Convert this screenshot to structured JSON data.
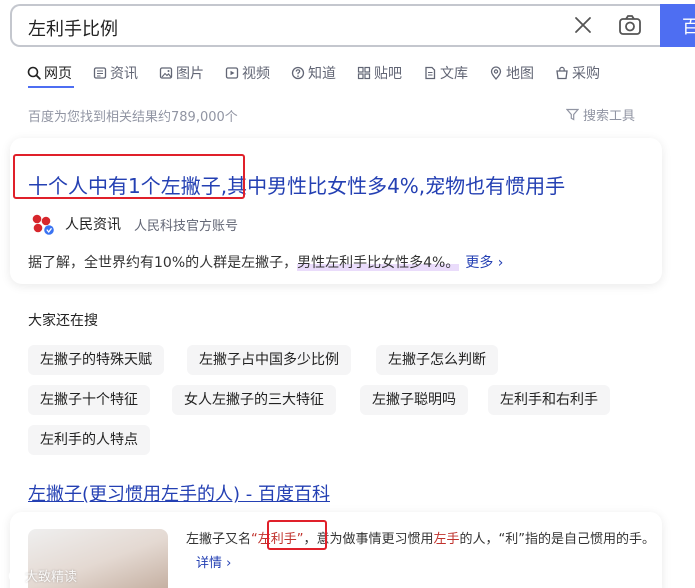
{
  "search": {
    "query": "左利手比例",
    "button_label": "百度一下"
  },
  "tabs": [
    {
      "label": "网页",
      "icon": "search-icon",
      "active": true
    },
    {
      "label": "资讯",
      "icon": "news-icon"
    },
    {
      "label": "图片",
      "icon": "image-icon"
    },
    {
      "label": "视频",
      "icon": "video-icon"
    },
    {
      "label": "知道",
      "icon": "question-icon"
    },
    {
      "label": "贴吧",
      "icon": "tieba-icon"
    },
    {
      "label": "文库",
      "icon": "document-icon"
    },
    {
      "label": "地图",
      "icon": "map-icon"
    },
    {
      "label": "采购",
      "icon": "bag-icon"
    }
  ],
  "result_count": "百度为您找到相关结果约789,000个",
  "tools_label": "搜索工具",
  "result1": {
    "title": "十个人中有1个左撇子,其中男性比女性多4%,宠物也有惯用手",
    "source_name": "人民资讯",
    "source_tag": "人民科技官方账号",
    "snippet_plain": "据了解，全世界约有10%的人群是左撇子，",
    "snippet_highlight": "男性左利手比女性多4%。",
    "more_label": "更多"
  },
  "related": {
    "heading": "大家还在搜",
    "row1": [
      "左撇子的特殊天赋",
      "左撇子占中国多少比例",
      "左撇子怎么判断"
    ],
    "row2": [
      "左撇子十个特征",
      "女人左撇子的三大特征",
      "左撇子聪明吗",
      "左利手和右利手"
    ],
    "row3": [
      "左利手的人特点"
    ]
  },
  "result2": {
    "title": "左撇子(更习惯用左手的人) - 百度百科",
    "text_a": "左撇子又名",
    "text_quote": "“左利手”",
    "text_b": "，意为做事情更习惯用",
    "text_red": "左手",
    "text_c": "的人，“利”指的是自己惯用的手。",
    "detail_label": "详情"
  },
  "watermark": "大致精读",
  "colors": {
    "brand_blue": "#4e6ef2",
    "link_blue": "#2440b3",
    "highlight_red": "#e0202a",
    "gray_text": "#9195a3"
  }
}
